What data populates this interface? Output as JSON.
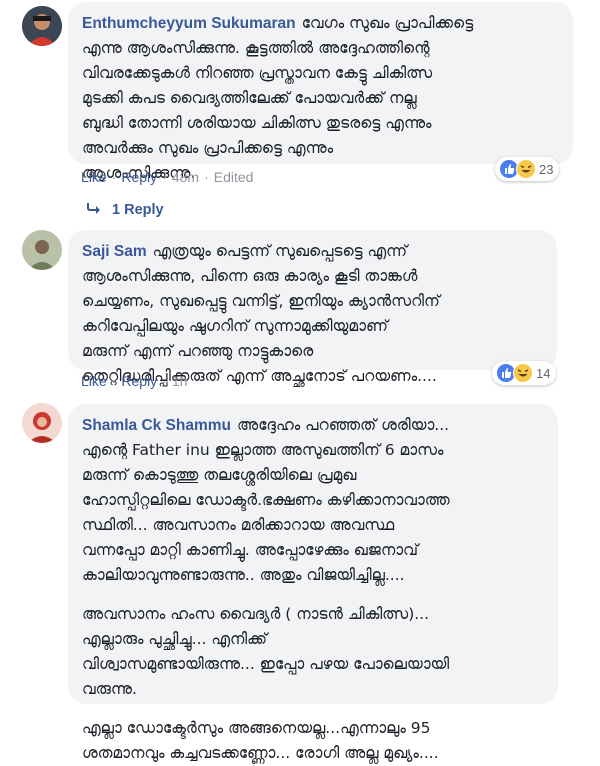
{
  "comments": [
    {
      "author": "Enthumcheyyum Sukumaran",
      "lines": [
        "വേഗം സുഖം പ്രാപിക്കട്ടെ",
        "എന്നു ആശംസിക്കുന്നു. കൂട്ടത്തിൽ അദ്ദേഹത്തിന്റെ",
        "വിവരക്കേടുകൾ നിറഞ്ഞ പ്രസ്താവന കേട്ടു ചികിത്സ",
        "മുടക്കി കപട വൈദ്യത്തിലേക്ക് പോയവർക്ക് നല്ല",
        "ബുദ്ധി തോന്നി ശരിയായ ചികിത്സ തുടരട്ടെ എന്നും",
        "അവർക്കും സുഖം പ്രാപിക്കട്ടെ എന്നും",
        "ആശംസിക്കുന്നു."
      ],
      "reaction_count": "23",
      "actions": {
        "like": "Like",
        "reply": "Reply",
        "time": "48m",
        "edited": "Edited"
      },
      "replies_link": "1 Reply"
    },
    {
      "author": "Saji Sam",
      "lines": [
        "എത്രയും പെട്ടന്ന് സുഖപ്പെടട്ടെ എന്ന്",
        "ആശംസിക്കുന്നു, പിന്നെ ഒരു കാര്യം കൂടി താങ്കൾ",
        "ചെയ്യണം, സുഖപ്പെട്ടു വന്നിട്ട്, ഇനിയും ക്യാൻസറിന്",
        "കറിവേപ്പിലയും ഷുഗറിന് സുന്നാമുക്കിയുമാണ്",
        "മരുന്ന് എന്ന് പറഞ്ഞു നാട്ടുകാരെ",
        "തെറ്റിദ്ധരിപ്പിക്കരുത് എന്ന് അച്ഛനോട് പറയണം...."
      ],
      "reaction_count": "14",
      "actions": {
        "like": "Like",
        "reply": "Reply",
        "time": "1h"
      }
    },
    {
      "author": "Shamla Ck Shammu",
      "paragraphs": [
        [
          "അദ്ദേഹം പറഞ്ഞത് ശരിയാ...",
          "എന്റെ Father inu ഇല്ലാത്ത അസുഖത്തിന് 6 മാസം",
          "മരുന്ന് കൊടുത്തു തലശ്ശേരിയിലെ പ്രമുഖ",
          "ഹോസ്പിറ്റലിലെ ഡോക്ടർ.ഭക്ഷണം കഴിക്കാനാവാത്ത",
          "സ്ഥിതി... അവസാനം മരിക്കാറായ അവസ്ഥ",
          "വന്നപ്പോ മാറ്റി കാണിച്ചു. അപ്പോഴേക്കും ഖജനാവ്",
          "കാലിയാവുന്നുണ്ടാരുന്നു.. അതും വിജയിച്ചില്ല...."
        ],
        [
          "അവസാനം ഹംസ വൈദ്യർ ( നാടൻ ചികിത്സ)...",
          "എല്ലാരും പുച്ഛിച്ചു... എനിക്ക്",
          "വിശ്വാസമുണ്ടായിരുന്നു... ഇപ്പോ പഴയ പോലെയായി",
          "വരുന്നു."
        ],
        [
          "എല്ലാ ഡോക്ടേർസും അങ്ങനെയല്ല...എന്നാലും 95",
          "ശതമാനവും കച്ചവടക്കണ്ണോ... രോഗി അല്ല മുഖ്യം...."
        ]
      ]
    }
  ],
  "colors": {
    "link": "#385898",
    "meta": "#90949c",
    "bubble": "#f2f3f5",
    "like_blue": "#4a7df0",
    "haha_yellow": "#f7c84a"
  },
  "icons": [
    "like-icon",
    "haha-icon",
    "reply-arrow-icon"
  ]
}
